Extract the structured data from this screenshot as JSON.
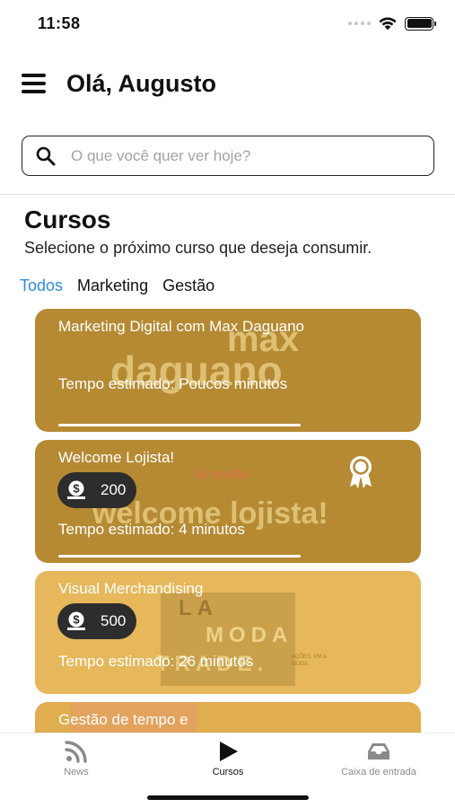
{
  "status_bar": {
    "time": "11:58"
  },
  "header": {
    "greeting": "Olá, Augusto"
  },
  "search": {
    "placeholder": "O que você quer ver hoje?"
  },
  "section": {
    "title": "Cursos",
    "subtitle": "Selecione o próximo curso que deseja consumir."
  },
  "filters": [
    {
      "label": "Todos",
      "active": true
    },
    {
      "label": "Marketing",
      "active": false
    },
    {
      "label": "Gestão",
      "active": false
    }
  ],
  "cards": [
    {
      "title": "Marketing Digital com Max Daguano",
      "time": "Tempo estimado: Poucos minutos",
      "art_lines": [
        "max",
        "daguano"
      ],
      "color": "#b58a33"
    },
    {
      "title": "Welcome Lojista!",
      "price": "200",
      "time": "Tempo estimado: 4 minutos",
      "art_small": "la moda",
      "art_big": "welcome lojista!",
      "color": "#b58a33"
    },
    {
      "title": "Visual Merchandising",
      "price": "500",
      "time": "Tempo estimado: 26 minutos",
      "art_lines": [
        "LA",
        "MODA",
        "TRADE."
      ],
      "art_side": "AÇÕES, VM & MODA.",
      "color": "#e6b85b"
    },
    {
      "title": "Gestão de tempo e",
      "color": "#e0ad4f"
    }
  ],
  "bottom_nav": {
    "news": "News",
    "cursos": "Cursos",
    "inbox": "Caixa de entrada",
    "active": "cursos"
  },
  "colors": {
    "accent_blue": "#2f8bdc",
    "card_dark_gold": "#b58a33",
    "card_light_gold": "#e6b85b",
    "badge_dark": "#2d2d2d"
  }
}
